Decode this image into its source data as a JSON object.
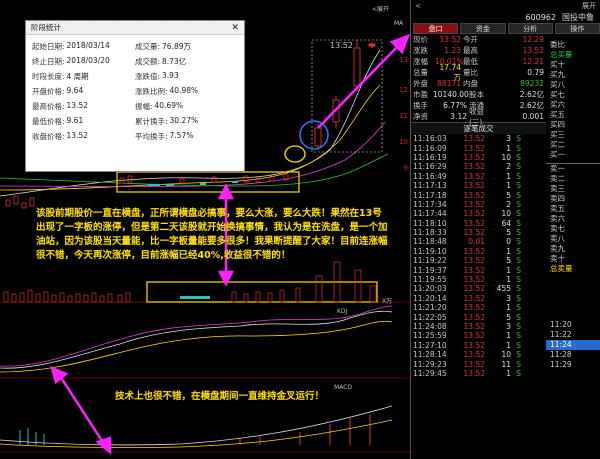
{
  "popup": {
    "title": "阶段统计",
    "close": "✕",
    "items": [
      {
        "k": "起始日期:",
        "v": "2018/03/14"
      },
      {
        "k": "成交量:",
        "v": "76.89万"
      },
      {
        "k": "终止日期:",
        "v": "2018/03/20"
      },
      {
        "k": "成交额:",
        "v": "8.73亿"
      },
      {
        "k": "时段长度:",
        "v": "4 周期"
      },
      {
        "k": "涨跌值:",
        "v": "3.93"
      },
      {
        "k": "开盘价格:",
        "v": "9.64"
      },
      {
        "k": "涨跌比例:",
        "v": "40.98%"
      },
      {
        "k": "最高价格:",
        "v": "13.52"
      },
      {
        "k": "振幅:",
        "v": "40.69%"
      },
      {
        "k": "最低价格:",
        "v": "9.61"
      },
      {
        "k": "累计换手:",
        "v": "30.27%"
      },
      {
        "k": "收盘价格:",
        "v": "13.52"
      },
      {
        "k": "平均换手:",
        "v": "7.57%"
      }
    ]
  },
  "annotations": {
    "main": "该股前期股价一直在横盘，正所谓横盘必搞事，要么大涨，要么大跌！果然在13号出现了一字板的涨停，但是第二天该股就开始换搞事情，我认为是在洗盘，是一个加油站，因为该股当天量能，比一字板量能要多很多！我果断提醒了大家！目前连涨幅很不错，今天再次涨停，目前涨幅已经40%,收益很不错的！",
    "tech": "技术上也很不错，在横盘期间一直维持金叉运行！"
  },
  "chart": {
    "peak_label": "13.52",
    "axis": [
      "13",
      "12",
      "11",
      "10",
      "9"
    ],
    "vol_label": "X万",
    "kdj_label": "KDJ",
    "macd_label": "MACD",
    "ma_label": "MA",
    "expand": "<展开",
    "top_r": "展开"
  },
  "right": {
    "top": {
      "left": "<",
      "right": "展开"
    },
    "code": "600962",
    "name": "国投中鲁",
    "tabs": [
      "盘口",
      "资金",
      "分析",
      "操作"
    ],
    "quote": [
      {
        "k": "现价",
        "v": "13.52",
        "k2": "今开",
        "v2": "12.29"
      },
      {
        "k": "涨跌",
        "v": "1.23",
        "k2": "最高",
        "v2": "13.52"
      },
      {
        "k": "涨幅",
        "v": "10.01%",
        "k2": "最低",
        "v2": "12.21"
      },
      {
        "k": "总量",
        "v": "17.74万",
        "k2": "量比",
        "v2": "0.79"
      },
      {
        "k": "外盘",
        "v": "88171",
        "k2": "内盘",
        "v2": "89232"
      }
    ],
    "sub": [
      {
        "k": "市盈",
        "v": "10140.00",
        "k2": "股本",
        "v2": "2.62亿"
      },
      {
        "k": "换手",
        "v": "6.77%",
        "k2": "流通",
        "v2": "2.62亿"
      },
      {
        "k": "净资",
        "v": "3.12",
        "k2": "收益(三)",
        "v2": "0.001"
      }
    ],
    "ticks_header": "逐笔成交",
    "ticks": [
      {
        "t": "11:16:03",
        "p": "13.52",
        "vol": "3",
        "s": "S"
      },
      {
        "t": "11:16:09",
        "p": "13.52",
        "vol": "1",
        "s": "S"
      },
      {
        "t": "11:16:19",
        "p": "13.52",
        "vol": "10",
        "s": "S"
      },
      {
        "t": "11:16:29",
        "p": "13.52",
        "vol": "2",
        "s": "S"
      },
      {
        "t": "11:16:49",
        "p": "13.52",
        "vol": "1",
        "s": "S"
      },
      {
        "t": "11:17:13",
        "p": "13.52",
        "vol": "1",
        "s": "S"
      },
      {
        "t": "11:17:18",
        "p": "13.52",
        "vol": "5",
        "s": "S"
      },
      {
        "t": "11:17:34",
        "p": "13.52",
        "vol": "2",
        "s": "S"
      },
      {
        "t": "11:17:44",
        "p": "13.52",
        "vol": "10",
        "s": "S"
      },
      {
        "t": "11:18:10",
        "p": "13.52",
        "vol": "64",
        "s": "S"
      },
      {
        "t": "11:18:33",
        "p": "13.52",
        "vol": "5",
        "s": "S"
      },
      {
        "t": "11:18:48",
        "p": "0.01",
        "vol": "0",
        "s": "S"
      },
      {
        "t": "11:19:10",
        "p": "13.52",
        "vol": "1",
        "s": "S"
      },
      {
        "t": "11:19:22",
        "p": "13.52",
        "vol": "5",
        "s": "S"
      },
      {
        "t": "11:19:37",
        "p": "13.52",
        "vol": "1",
        "s": "S"
      },
      {
        "t": "11:19:55",
        "p": "13.52",
        "vol": "1",
        "s": "S"
      },
      {
        "t": "11:20:03",
        "p": "13.52",
        "vol": "455",
        "s": "S"
      },
      {
        "t": "11:20:14",
        "p": "13.52",
        "vol": "3",
        "s": "S"
      },
      {
        "t": "11:21:20",
        "p": "13.52",
        "vol": "1",
        "s": "S"
      },
      {
        "t": "11:22:05",
        "p": "13.52",
        "vol": "5",
        "s": "S"
      },
      {
        "t": "11:24:08",
        "p": "13.52",
        "vol": "3",
        "s": "S"
      },
      {
        "t": "11:25:59",
        "p": "13.52",
        "vol": "1",
        "s": "S"
      },
      {
        "t": "11:27:10",
        "p": "13.52",
        "vol": "1",
        "s": "S"
      },
      {
        "t": "11:28:14",
        "p": "13.52",
        "vol": "10",
        "s": "S"
      },
      {
        "t": "11:29:23",
        "p": "13.52",
        "vol": "11",
        "s": "S"
      },
      {
        "t": "11:29:45",
        "p": "13.52",
        "vol": "1",
        "s": "S"
      }
    ],
    "book_top": [
      "委比",
      "总买量",
      "买十",
      "买九",
      "买八",
      "买七",
      "买六",
      "买五",
      "买四",
      "买三",
      "买二",
      "买一"
    ],
    "book_bottom": [
      "卖一",
      "卖二",
      "卖三",
      "卖四",
      "卖五",
      "卖六",
      "卖七",
      "卖八",
      "卖九",
      "卖十",
      "总卖量"
    ],
    "timelist": [
      "11:20",
      "11:22",
      "11:24",
      "11:28",
      "11:29"
    ]
  }
}
